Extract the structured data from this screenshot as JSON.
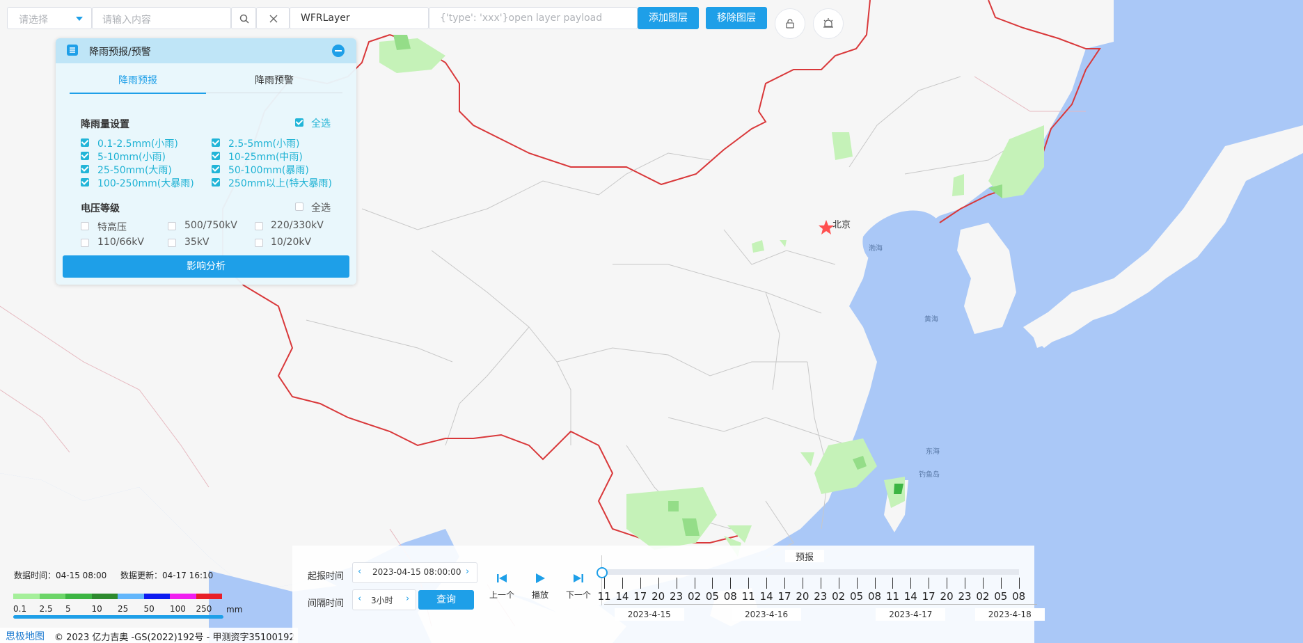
{
  "toolbar": {
    "select_placeholder": "请选择",
    "search_placeholder": "请输入内容",
    "layer_name_value": "WFRLayer",
    "payload_placeholder": "{'type': 'xxx'}open layer payload",
    "add_layer_label": "添加图层",
    "remove_layer_label": "移除图层"
  },
  "map_labels": {
    "beijing": "北京",
    "bohai": "渤海",
    "huanghai": "黄海",
    "donghai": "东海",
    "diaoyudao": "钓鱼岛"
  },
  "panel": {
    "title": "降雨预报/预警",
    "tabs": [
      "降雨预报",
      "降雨预警"
    ],
    "rain_section_title": "降雨量设置",
    "rain_select_all": "全选",
    "rain_options": [
      "0.1-2.5mm(小雨)",
      "2.5-5mm(小雨)",
      "5-10mm(小雨)",
      "10-25mm(中雨)",
      "25-50mm(大雨)",
      "50-100mm(暴雨)",
      "100-250mm(大暴雨)",
      "250mm以上(特大暴雨)"
    ],
    "voltage_section_title": "电压等级",
    "voltage_select_all": "全选",
    "voltage_options": [
      "特高压",
      "500/750kV",
      "220/330kV",
      "110/66kV",
      "35kV",
      "10/20kV"
    ],
    "analyze_button": "影响分析"
  },
  "info": {
    "data_time": "数据时间：04-15 08:00",
    "data_update": "数据更新：04-17 16:10"
  },
  "legend": {
    "colors": [
      "#a5ef9a",
      "#6cd568",
      "#3cb543",
      "#2d8a2e",
      "#62b6fb",
      "#0d1bf0",
      "#f01ef0",
      "#e81f28"
    ],
    "labels": [
      "0.1",
      "2.5",
      "5",
      "10",
      "25",
      "50",
      "100",
      "250"
    ],
    "unit": "mm"
  },
  "footer": {
    "logo_text": "思极地图",
    "copyright": "© 2023 亿力吉奥 -GS(2022)192号 - 甲测资字35100192"
  },
  "timeline": {
    "start_label": "起报时间",
    "start_value": "2023-04-15 08:00:00",
    "interval_label": "间隔时间",
    "interval_value": "3小时",
    "query_button": "查询",
    "prev_label": "上一个",
    "play_label": "播放",
    "next_label": "下一个",
    "mode_label": "预报",
    "hours": [
      "11",
      "14",
      "17",
      "20",
      "23",
      "02",
      "05",
      "08",
      "11",
      "14",
      "17",
      "20",
      "23",
      "02",
      "05",
      "08",
      "11",
      "14",
      "17",
      "20",
      "23",
      "02",
      "05",
      "08"
    ],
    "dates": [
      "2023-4-15",
      "2023-4-16",
      "2023-4-17",
      "2023-4-18"
    ]
  }
}
